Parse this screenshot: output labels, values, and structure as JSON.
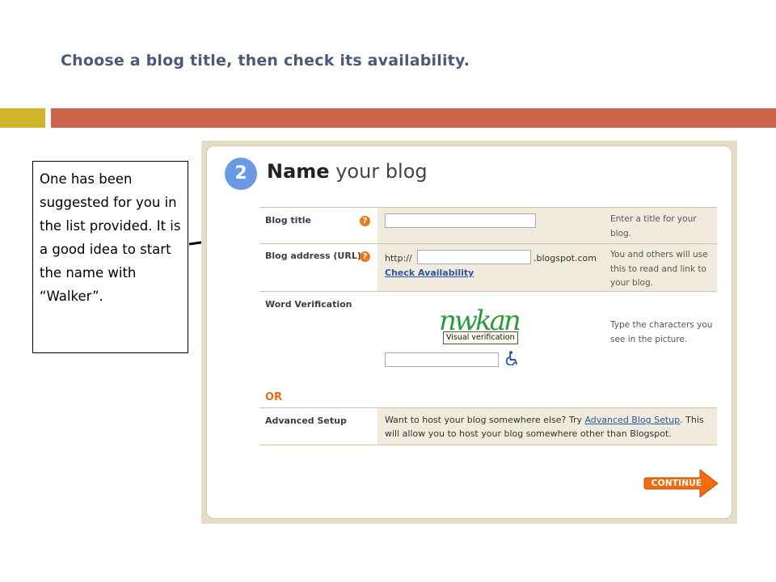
{
  "slide": {
    "title": "Choose a blog title, then check its availability.",
    "callout": "One has been suggested for you in the list provided.  It is a good idea to start the name with “Walker”."
  },
  "form": {
    "step": "2",
    "heading_strong": "Name",
    "heading_light": " your blog",
    "blog_title_label": "Blog title",
    "blog_title_value": "",
    "blog_title_hint": "Enter a title for your blog.",
    "blog_address_label": "Blog address (URL)",
    "url_prefix": "http://",
    "url_value": "",
    "url_suffix": ".blogspot.com",
    "check_availability": "Check Availability",
    "blog_address_hint": "You and others will use this to read and link to your blog.",
    "word_verification_label": "Word Verification",
    "captcha_text": "nwkan",
    "captcha_tooltip": "Visual verification",
    "word_verification_value": "",
    "word_verification_hint": "Type the characters you see in the picture.",
    "or": "OR",
    "advanced_setup_label": "Advanced Setup",
    "advanced_text_1": "Want to host your blog somewhere else? Try ",
    "advanced_link": "Advanced Blog Setup",
    "advanced_text_2": ". This will allow you to host your blog somewhere other than Blogspot.",
    "continue": "CONTINUE",
    "help_glyph": "?"
  },
  "icons": {
    "help": "question-circle-icon",
    "accessibility": "wheelchair-icon",
    "continue": "arrow-right-icon"
  },
  "colors": {
    "title": "#4a5a78",
    "bar_left": "#cfb52a",
    "bar_right": "#cd6449",
    "step_circle": "#6a9ae6",
    "accent_orange": "#e86b18",
    "link": "#2a56a8"
  }
}
